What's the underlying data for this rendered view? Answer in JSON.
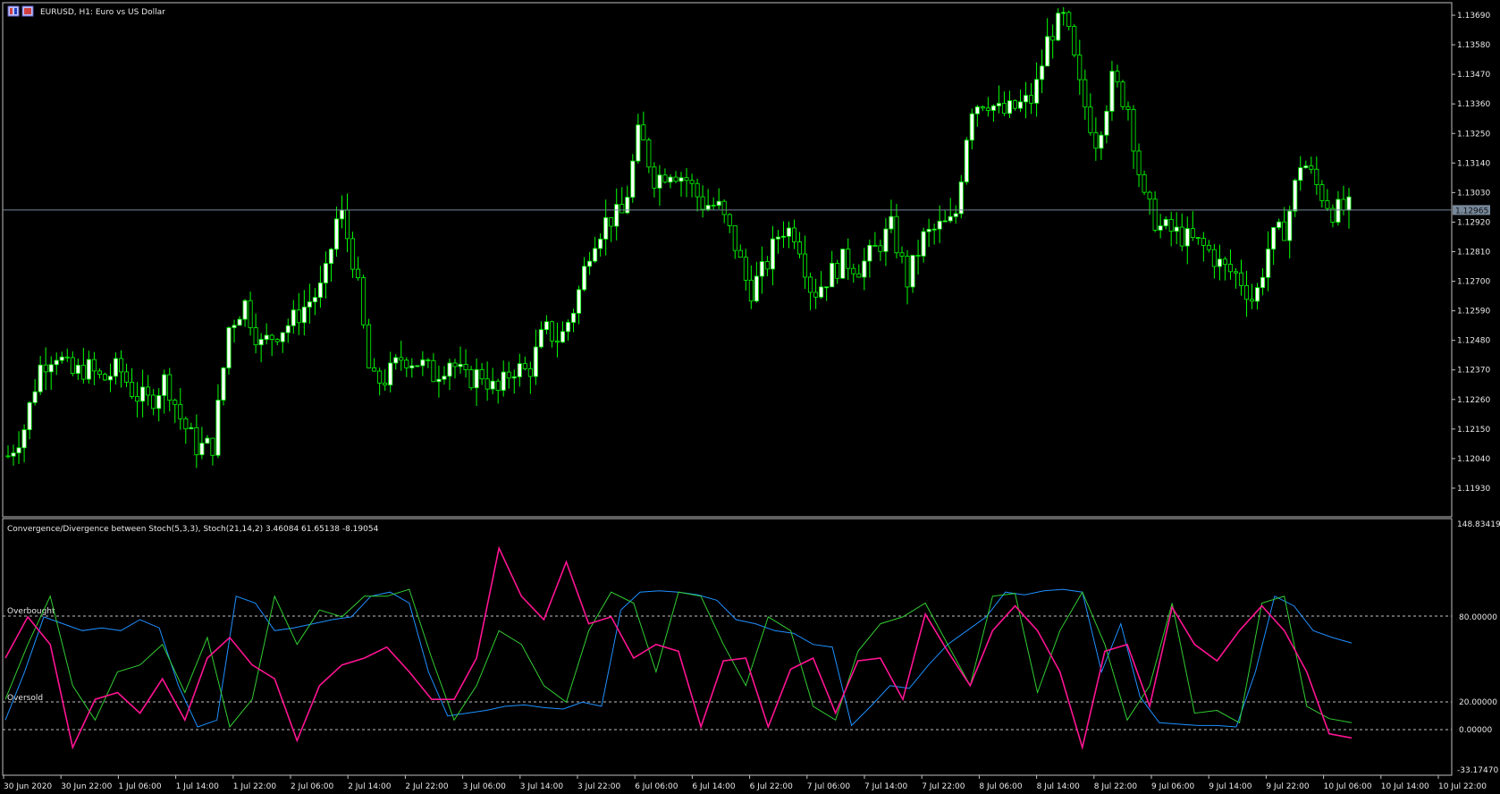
{
  "window": {
    "title": "EURUSD, H1:  Euro vs US Dollar",
    "icon": "chart-window-icon"
  },
  "indicator": {
    "label": "Convergence/Divergence between Stoch(5,3,3), Stoch(21,14,2) 3.46084 61.65138 -8.19054",
    "overbought_label": "Overbought",
    "oversold_label": "Oversold",
    "scale_max": "148.83419",
    "scale_min": "-33.17470",
    "level_high": "80.00000",
    "level_mid": "20.00000",
    "level_zero": "0.00000"
  },
  "colors": {
    "background": "#000000",
    "frame": "#c0c0c0",
    "bull_candle": "#ffffff",
    "candle_wick": "#00ff00",
    "current_price_line": "#778899",
    "price_label_bg": "#778899",
    "stoch_fast": "#1e90ff",
    "stoch_slow": "#32cd32",
    "divergence_main": "#ff1493",
    "divergence_alt": "#c71585",
    "divergence_flat": "#d0d0d0",
    "level_line": "#c0c0c0"
  },
  "chart_data": [
    {
      "type": "candlestick",
      "symbol": "EURUSD",
      "timeframe": "H1",
      "title": "EURUSD, H1:  Euro vs US Dollar",
      "current_price": "1.12965",
      "y_ticks": [
        "1.13690",
        "1.13580",
        "1.13470",
        "1.13360",
        "1.13250",
        "1.13140",
        "1.13030",
        "1.12920",
        "1.12810",
        "1.12700",
        "1.12590",
        "1.12480",
        "1.12370",
        "1.12260",
        "1.12150",
        "1.12040",
        "1.11930"
      ],
      "ylim": [
        1.1185,
        1.1372
      ],
      "x_ticks": [
        "30 Jun 2020",
        "30 Jun 22:00",
        "1 Jul 06:00",
        "1 Jul 14:00",
        "1 Jul 22:00",
        "2 Jul 06:00",
        "2 Jul 14:00",
        "2 Jul 22:00",
        "3 Jul 06:00",
        "3 Jul 14:00",
        "3 Jul 22:00",
        "6 Jul 06:00",
        "6 Jul 14:00",
        "6 Jul 22:00",
        "7 Jul 06:00",
        "7 Jul 14:00",
        "7 Jul 22:00",
        "8 Jul 06:00",
        "8 Jul 14:00",
        "8 Jul 22:00",
        "9 Jul 06:00",
        "9 Jul 14:00",
        "9 Jul 22:00",
        "10 Jul 06:00",
        "10 Jul 14:00",
        "10 Jul 22:00"
      ],
      "close_path": [
        1.1205,
        1.1215,
        1.1238,
        1.1244,
        1.1235,
        1.1238,
        1.1233,
        1.1238,
        1.1228,
        1.1225,
        1.1234,
        1.1218,
        1.1208,
        1.1209,
        1.1253,
        1.1262,
        1.1246,
        1.1251,
        1.1255,
        1.1262,
        1.1268,
        1.1298,
        1.1275,
        1.1232,
        1.1234,
        1.1242,
        1.124,
        1.1235,
        1.1241,
        1.1233,
        1.1236,
        1.1228,
        1.1238,
        1.1236,
        1.1252,
        1.1248,
        1.1262,
        1.1285,
        1.1293,
        1.1295,
        1.1326,
        1.1308,
        1.1312,
        1.1308,
        1.1299,
        1.1298,
        1.1285,
        1.1266,
        1.1275,
        1.129,
        1.1288,
        1.1265,
        1.1272,
        1.1278,
        1.1275,
        1.1282,
        1.129,
        1.127,
        1.1286,
        1.129,
        1.1292,
        1.1335,
        1.1338,
        1.1332,
        1.1335,
        1.1338,
        1.1362,
        1.1368,
        1.134,
        1.1322,
        1.1345,
        1.1335,
        1.13,
        1.129,
        1.1288,
        1.1285,
        1.1282,
        1.1275,
        1.1272,
        1.1262,
        1.1285,
        1.129,
        1.1316,
        1.1305,
        1.1296,
        1.1297
      ]
    },
    {
      "type": "line",
      "title": "Convergence/Divergence between Stoch(5,3,3), Stoch(21,14,2) 3.46084 61.65138 -8.19054",
      "ylim": [
        -33.1747,
        148.83419
      ],
      "levels": [
        80,
        20,
        0
      ],
      "series": [
        {
          "values": [
            5,
            40,
            80,
            75,
            70,
            72,
            70,
            78,
            72,
            30,
            0,
            5,
            95,
            90,
            70,
            72,
            75,
            78,
            80,
            95,
            98,
            90,
            40,
            8,
            10,
            12,
            15,
            16,
            14,
            13,
            18,
            15,
            85,
            98,
            99,
            98,
            96,
            92,
            78,
            75,
            70,
            68,
            60,
            58,
            1,
            15,
            30,
            28,
            45,
            60,
            70,
            80,
            98,
            96,
            99,
            100,
            98,
            40,
            75,
            22,
            3,
            2,
            1,
            1,
            0,
            40,
            95,
            88,
            70,
            65,
            61
          ]
        },
        {
          "values": [
            20,
            60,
            95,
            30,
            5,
            40,
            45,
            60,
            25,
            65,
            0,
            20,
            95,
            60,
            85,
            80,
            95,
            95,
            100,
            50,
            5,
            30,
            70,
            60,
            30,
            18,
            70,
            98,
            90,
            40,
            98,
            95,
            60,
            30,
            80,
            70,
            15,
            5,
            55,
            75,
            80,
            90,
            60,
            30,
            95,
            97,
            25,
            70,
            98,
            60,
            5,
            30,
            90,
            10,
            12,
            3,
            90,
            95,
            15,
            6,
            3
          ]
        },
        {
          "values": [
            50,
            80,
            60,
            -15,
            20,
            25,
            10,
            35,
            5,
            50,
            65,
            45,
            35,
            -10,
            30,
            45,
            50,
            58,
            40,
            20,
            20,
            50,
            130,
            95,
            78,
            120,
            75,
            80,
            50,
            60,
            55,
            0,
            48,
            50,
            0,
            42,
            50,
            10,
            48,
            50,
            20,
            82,
            55,
            30,
            70,
            88,
            70,
            40,
            -15,
            55,
            60,
            15,
            87,
            60,
            48,
            70,
            88,
            70,
            40,
            -5,
            -8
          ]
        }
      ]
    }
  ]
}
